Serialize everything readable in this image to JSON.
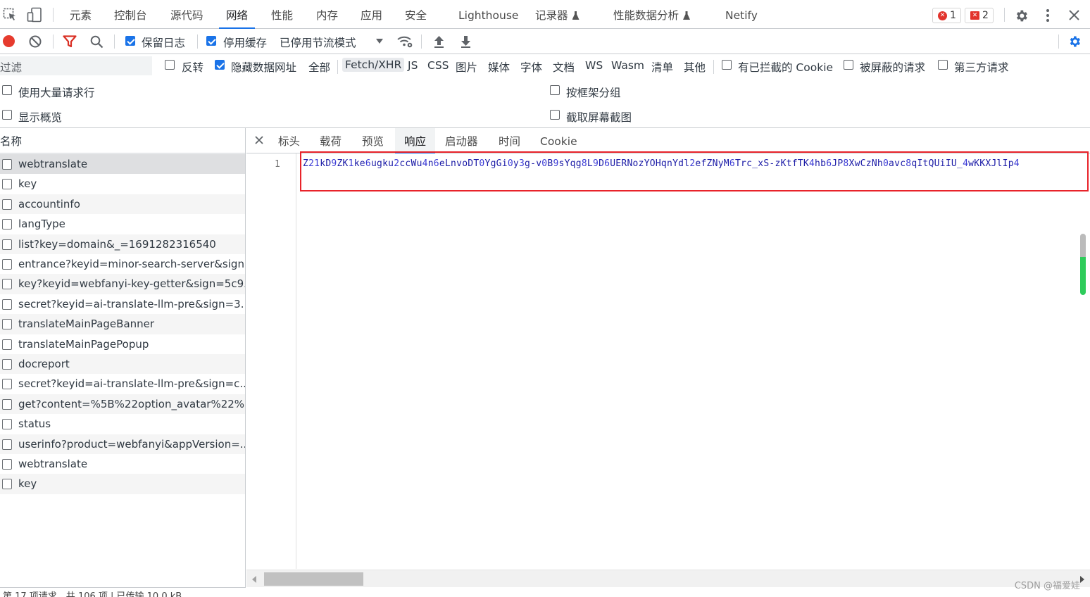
{
  "tabs": [
    {
      "label": "元素"
    },
    {
      "label": "控制台"
    },
    {
      "label": "源代码"
    },
    {
      "label": "网络"
    },
    {
      "label": "性能"
    },
    {
      "label": "内存"
    },
    {
      "label": "应用"
    },
    {
      "label": "安全"
    },
    {
      "label": "Lighthouse"
    },
    {
      "label": "记录器"
    },
    {
      "label": "性能数据分析"
    },
    {
      "label": "Netify"
    }
  ],
  "badges": {
    "errors": "1",
    "issues": "2"
  },
  "toolbar": {
    "preserve_log": "保留日志",
    "disable_cache": "停用缓存",
    "throttle": "已停用节流模式"
  },
  "filter": {
    "placeholder": "过滤",
    "invert": "反转",
    "hide_data_urls": "隐藏数据网址",
    "types": [
      "全部",
      "Fetch/XHR",
      "JS",
      "CSS",
      "图片",
      "媒体",
      "字体",
      "文档",
      "WS",
      "Wasm",
      "清单",
      "其他"
    ],
    "blocked_cookies": "有已拦截的 Cookie",
    "blocked_requests": "被屏蔽的请求",
    "third_party": "第三方请求"
  },
  "options": {
    "big_rows": "使用大量请求行",
    "group_by_frame": "按框架分组",
    "overview": "显示概览",
    "screenshots": "截取屏幕截图"
  },
  "list": {
    "header": "名称",
    "requests": [
      "webtranslate",
      "key",
      "accountinfo",
      "langType",
      "list?key=domain&_=1691282316540",
      "entrance?keyid=minor-search-server&sign...",
      "key?keyid=webfanyi-key-getter&sign=5c9...",
      "secret?keyid=ai-translate-llm-pre&sign=3...",
      "translateMainPageBanner",
      "translateMainPagePopup",
      "docreport",
      "secret?keyid=ai-translate-llm-pre&sign=c...",
      "get?content=%5B%22option_avatar%22%...",
      "status",
      "userinfo?product=webfanyi&appVersion=...",
      "webtranslate",
      "key"
    ],
    "footer": "第 17 项请求，共 106 项 | 已传输 10.0 kB"
  },
  "detail": {
    "tabs": [
      "标头",
      "载荷",
      "预览",
      "响应",
      "启动器",
      "时间",
      "Cookie"
    ],
    "line_number": "1",
    "response_text": "Z21kD9ZK1ke6ugku2ccWu4n6eLnvoDT0YgGi0y3g-v0B9sYqg8L9D6UERNozYOHqnYdl2efZNyM6Trc_xS-zKtfTK4hb6JP8XwCzNh0avc8qItQUiIU_4wKKXJlIp4"
  },
  "watermark": "CSDN @福爱娃",
  "colors": {
    "accent": "#1a73e8",
    "error": "#e2332c",
    "highlight_box": "#e8232a",
    "record": "#e63b2e"
  }
}
